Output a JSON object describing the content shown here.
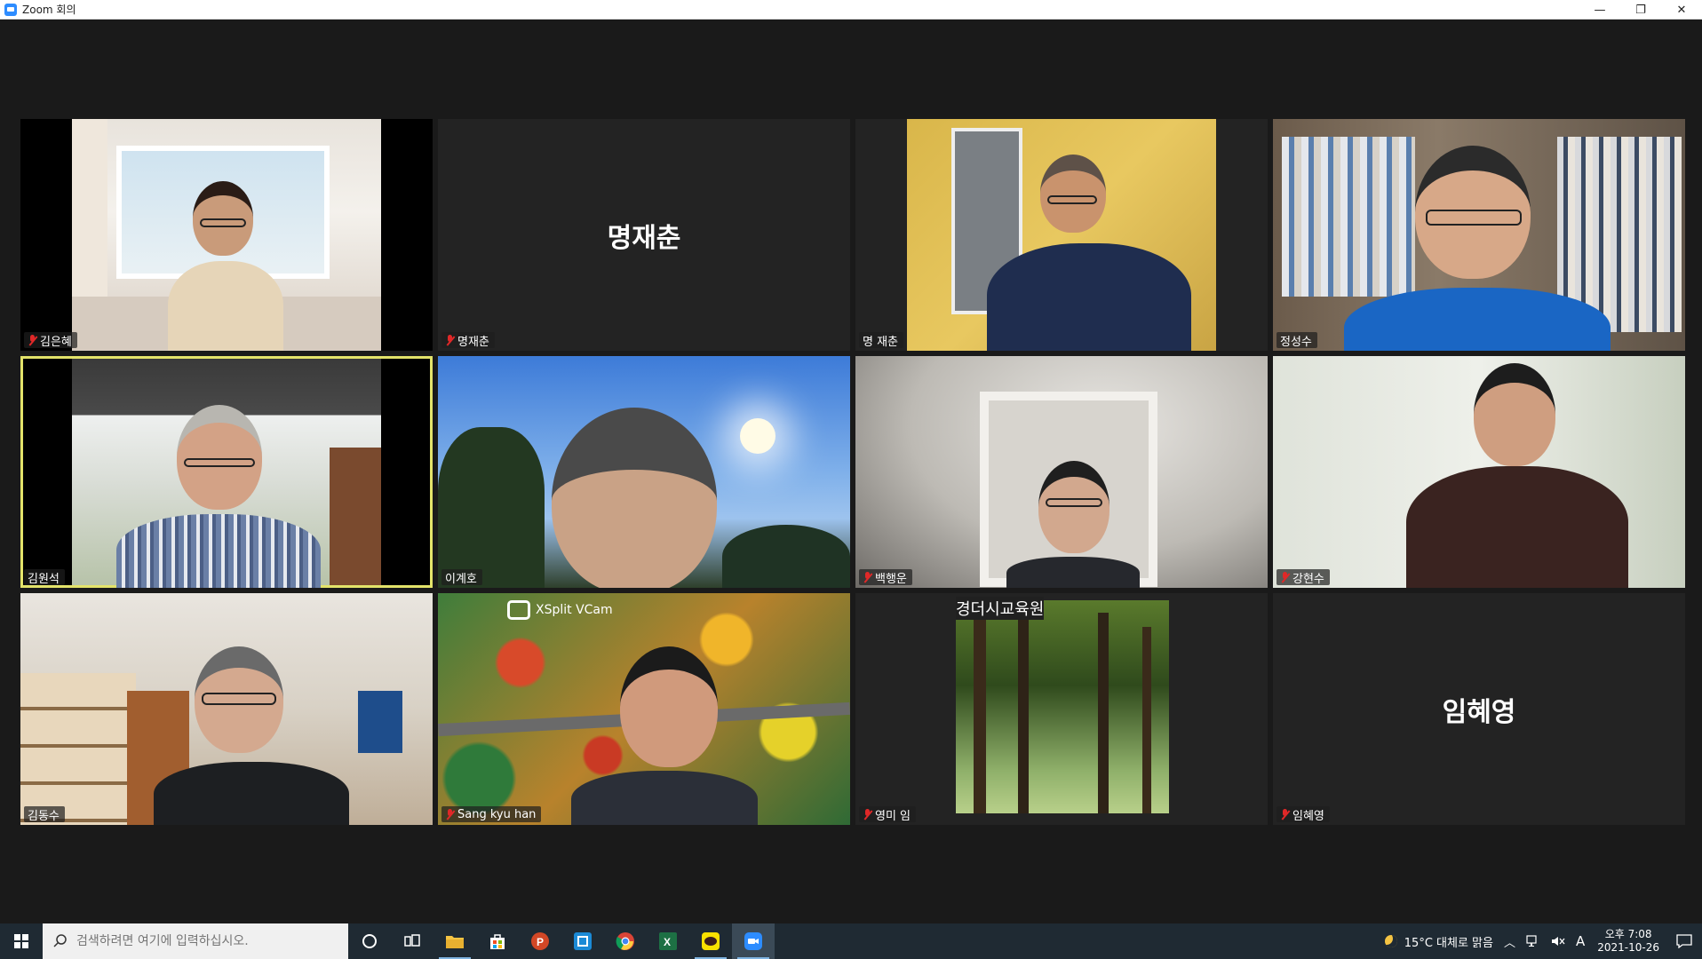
{
  "window": {
    "title": "Zoom 회의",
    "controls": {
      "minimize": "—",
      "restore": "❐",
      "close": "✕"
    }
  },
  "participants": [
    {
      "name": "김은혜",
      "muted": true,
      "video": true
    },
    {
      "name": "명재춘",
      "muted": true,
      "video": false,
      "display": "명재춘"
    },
    {
      "name": "명 재춘",
      "muted": false,
      "video": true
    },
    {
      "name": "정성수",
      "muted": false,
      "video": true
    },
    {
      "name": "김원석",
      "muted": false,
      "video": true,
      "active_speaker": true
    },
    {
      "name": "이계호",
      "muted": false,
      "video": true
    },
    {
      "name": "백행운",
      "muted": true,
      "video": true
    },
    {
      "name": "강현수",
      "muted": true,
      "video": true
    },
    {
      "name": "김동수",
      "muted": false,
      "video": true
    },
    {
      "name": "Sang kyu han",
      "muted": true,
      "video": true,
      "overlay": "XSplit VCam"
    },
    {
      "name": "영미 임",
      "muted": true,
      "video": true,
      "overlay": "경더시교육원"
    },
    {
      "name": "임혜영",
      "muted": true,
      "video": false,
      "display": "임혜영"
    }
  ],
  "taskbar": {
    "search_placeholder": "검색하려면 여기에 입력하십시오.",
    "weather": "15°C 대체로 맑음",
    "ime": "A",
    "time": "오후 7:08",
    "date": "2021-10-26",
    "apps": [
      "task-view",
      "file-explorer",
      "store",
      "powerpoint",
      "app-blue",
      "chrome",
      "excel",
      "kakaotalk",
      "zoom"
    ]
  },
  "colors": {
    "active_speaker_border": "#e3e36a",
    "muted_mic": "#e02828",
    "zoom_blue": "#2d8cff"
  }
}
